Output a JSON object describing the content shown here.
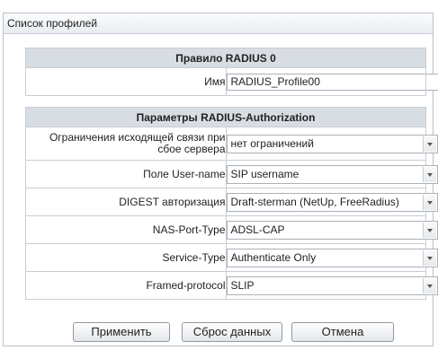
{
  "panel": {
    "title": "Список профилей"
  },
  "rule_section": {
    "header": "Правило RADIUS 0",
    "name_label": "Имя",
    "name_value": "RADIUS_Profile00"
  },
  "auth_section": {
    "header": "Параметры RADIUS-Authorization",
    "rows": [
      {
        "label": "Ограничения исходящей связи при сбое сервера",
        "value": "нет ограничений"
      },
      {
        "label": "Поле User-name",
        "value": "SIP username"
      },
      {
        "label": "DIGEST авторизация",
        "value": "Draft-sterman (NetUp, FreeRadius)"
      },
      {
        "label": "NAS-Port-Type",
        "value": "ADSL-CAP"
      },
      {
        "label": "Service-Type",
        "value": "Authenticate Only"
      },
      {
        "label": "Framed-protocol",
        "value": "SLIP"
      }
    ]
  },
  "buttons": {
    "apply": "Применить",
    "reset": "Сброс данных",
    "cancel": "Отмена"
  }
}
